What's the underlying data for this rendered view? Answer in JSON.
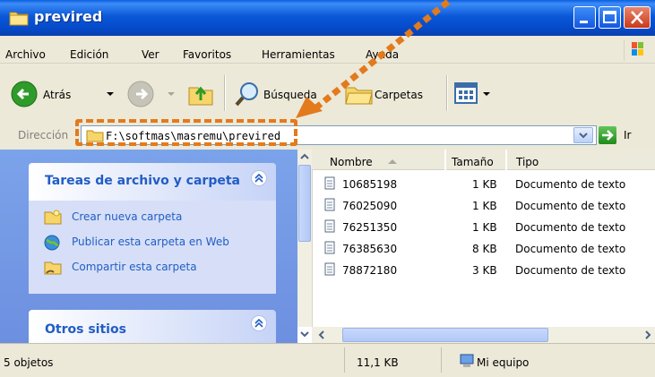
{
  "window": {
    "title": "previred"
  },
  "menu": {
    "items": [
      {
        "label": "Archivo"
      },
      {
        "label": "Edición"
      },
      {
        "label": "Ver"
      },
      {
        "label": "Favoritos"
      },
      {
        "label": "Herramientas"
      },
      {
        "label": "Ayuda"
      }
    ]
  },
  "toolbar": {
    "back_label": "Atrás",
    "search_label": "Búsqueda",
    "folders_label": "Carpetas"
  },
  "address": {
    "label": "Dirección",
    "value": "F:\\softmas\\masremu\\previred",
    "go_label": "Ir"
  },
  "tasks": {
    "title": "Tareas de archivo y carpeta",
    "items": [
      {
        "label": "Crear nueva carpeta",
        "icon": "new-folder-icon"
      },
      {
        "label": "Publicar esta carpeta en Web",
        "icon": "globe-icon"
      },
      {
        "label": "Compartir esta carpeta",
        "icon": "share-folder-icon"
      }
    ]
  },
  "other_places": {
    "title": "Otros sitios"
  },
  "files": {
    "columns": [
      {
        "label": "Nombre",
        "sorted": "asc"
      },
      {
        "label": "Tamaño"
      },
      {
        "label": "Tipo"
      }
    ],
    "rows": [
      {
        "name": "10685198",
        "size": "1 KB",
        "type": "Documento de texto"
      },
      {
        "name": "76025090",
        "size": "1 KB",
        "type": "Documento de texto"
      },
      {
        "name": "76251350",
        "size": "1 KB",
        "type": "Documento de texto"
      },
      {
        "name": "76385630",
        "size": "8 KB",
        "type": "Documento de texto"
      },
      {
        "name": "78872180",
        "size": "3 KB",
        "type": "Documento de texto"
      }
    ]
  },
  "status": {
    "count": "5 objetos",
    "size": "11,1 KB",
    "location": "Mi equipo"
  },
  "colors": {
    "titlebar": "#0a58d8",
    "task_link": "#215dc6",
    "annotation": "#e37a1c"
  }
}
